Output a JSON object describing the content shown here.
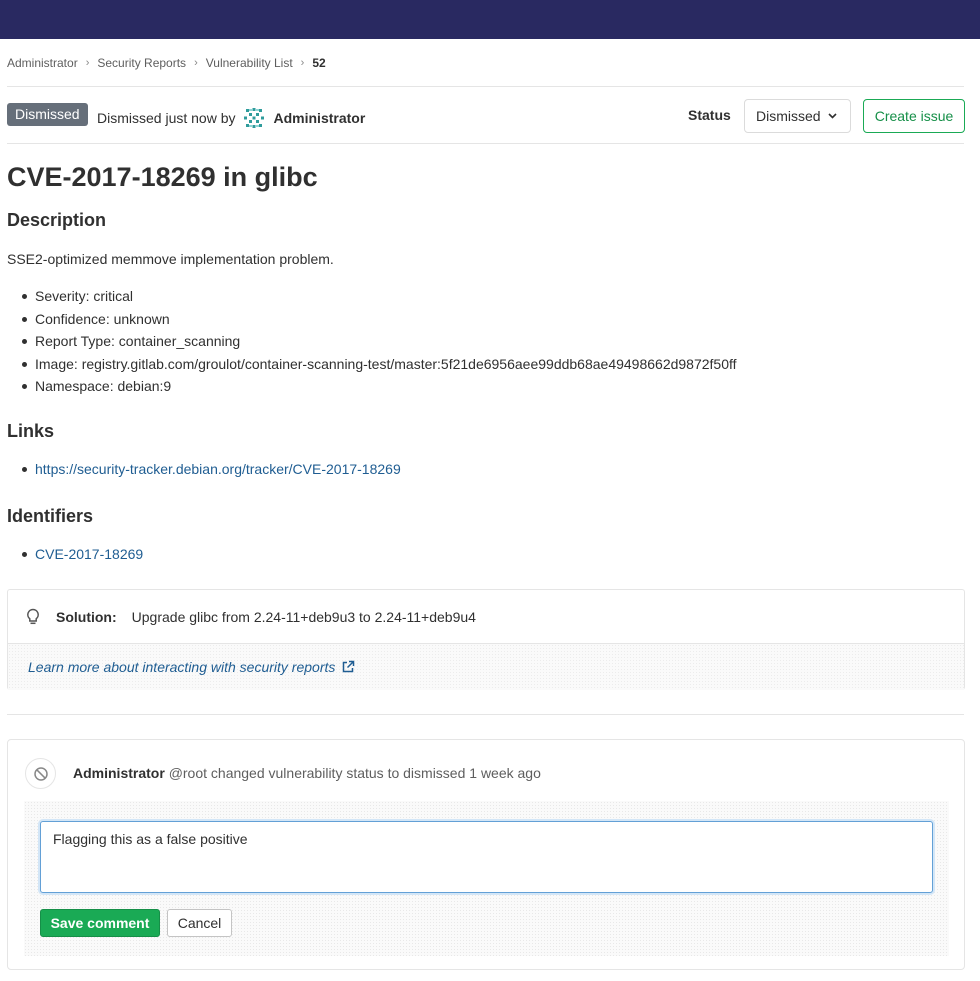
{
  "breadcrumb": {
    "items": [
      "Administrator",
      "Security Reports",
      "Vulnerability List"
    ],
    "current": "52"
  },
  "header": {
    "badge": "Dismissed",
    "dismissed_text": "Dismissed just now by",
    "user_name": "Administrator",
    "status_label": "Status",
    "status_value": "Dismissed",
    "create_issue_label": "Create issue"
  },
  "vulnerability": {
    "title": "CVE-2017-18269 in glibc",
    "description_heading": "Description",
    "description": "SSE2-optimized memmove implementation problem.",
    "details": [
      "Severity: critical",
      "Confidence: unknown",
      "Report Type: container_scanning",
      "Image: registry.gitlab.com/groulot/container-scanning-test/master:5f21de6956aee99ddb68ae49498662d9872f50ff",
      "Namespace: debian:9"
    ],
    "links_heading": "Links",
    "links": [
      "https://security-tracker.debian.org/tracker/CVE-2017-18269"
    ],
    "identifiers_heading": "Identifiers",
    "identifiers": [
      "CVE-2017-18269"
    ]
  },
  "solution": {
    "label": "Solution:",
    "text": "Upgrade glibc from 2.24-11+deb9u3 to 2.24-11+deb9u4",
    "learn_more": "Learn more about interacting with security reports"
  },
  "discussion": {
    "author": "Administrator",
    "note": "@root changed vulnerability status to dismissed 1 week ago",
    "comment_value": "Flagging this as a false positive",
    "save_label": "Save comment",
    "cancel_label": "Cancel"
  },
  "colors": {
    "topbar": "#292961",
    "badge": "#666f7a",
    "success": "#1aaa55",
    "link": "#1f5d92"
  },
  "icons": {
    "avatar": "identicon-avatar",
    "solution": "lightbulb-icon",
    "external": "external-link-icon",
    "system_note": "cancel-icon",
    "status_dropdown": "chevron-down-icon"
  }
}
